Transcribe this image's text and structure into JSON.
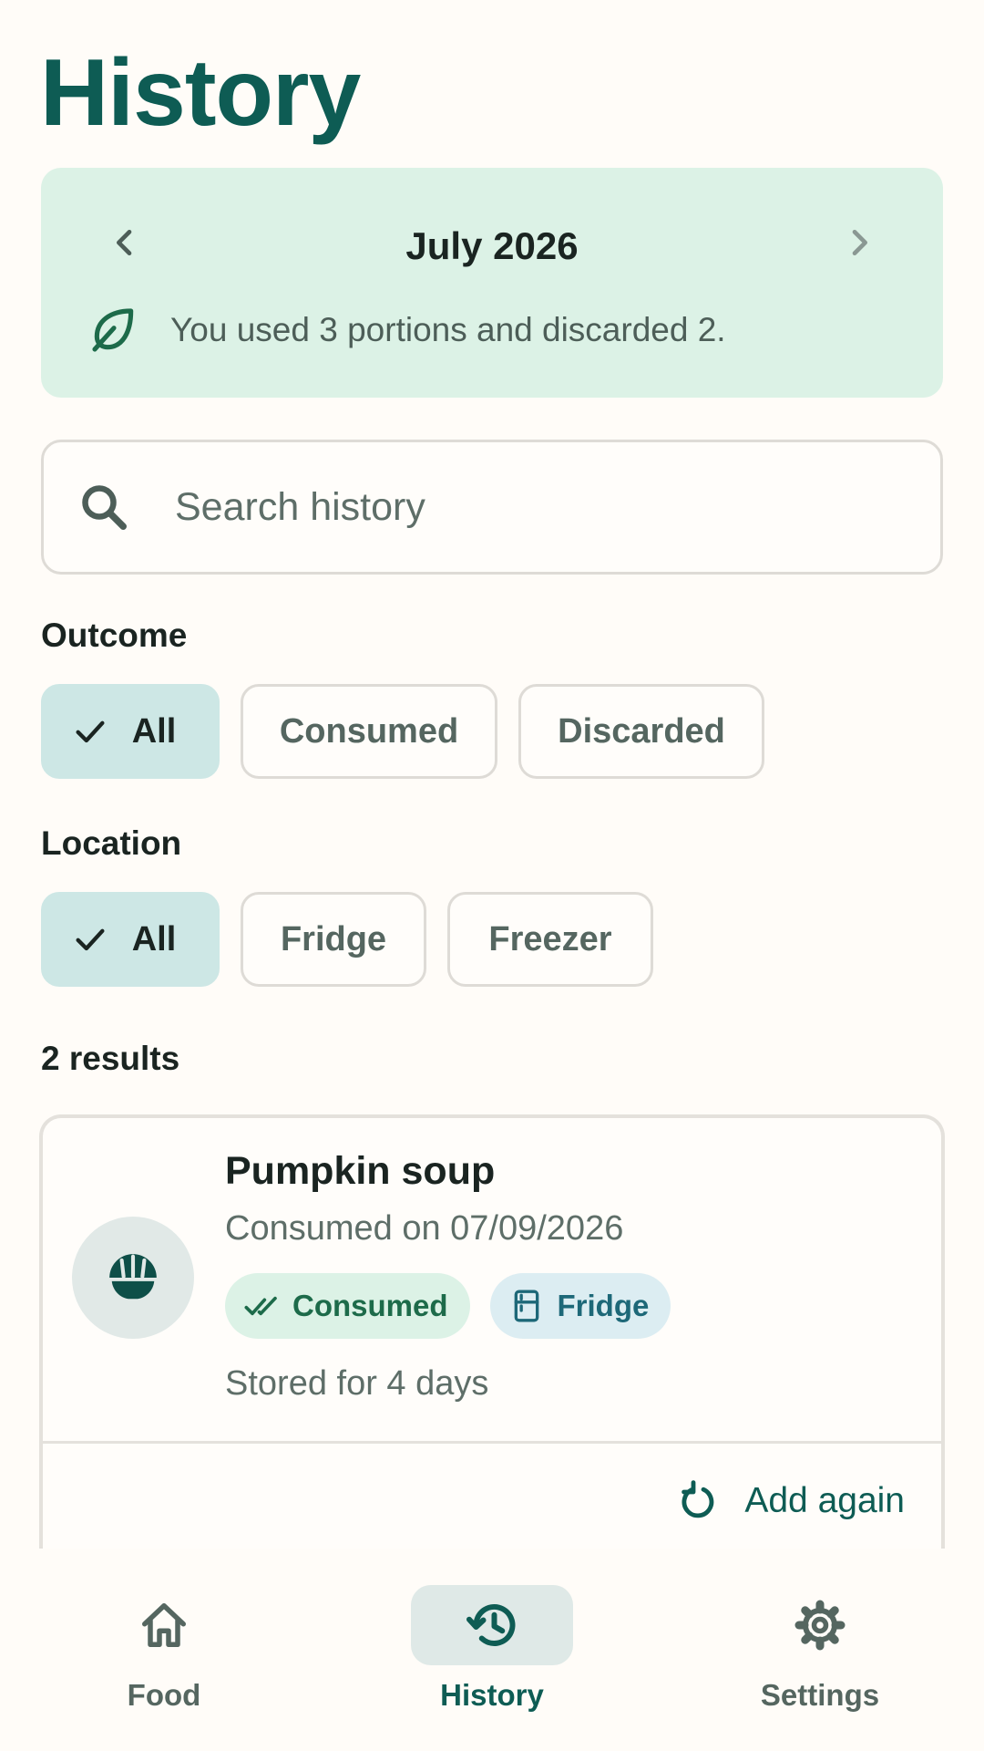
{
  "page": {
    "title": "History"
  },
  "month": {
    "label": "July 2026",
    "summary": "You used 3 portions and discarded 2."
  },
  "search": {
    "placeholder": "Search history",
    "value": ""
  },
  "filters": {
    "outcome": {
      "label": "Outcome",
      "options": [
        "All",
        "Consumed",
        "Discarded"
      ],
      "selected": "All"
    },
    "location": {
      "label": "Location",
      "options": [
        "All",
        "Fridge",
        "Freezer"
      ],
      "selected": "All"
    }
  },
  "results": {
    "count_label": "2 results",
    "items": [
      {
        "name": "Pumpkin soup",
        "date": "Consumed on 07/09/2026",
        "outcome_badge": "Consumed",
        "location_badge": "Fridge",
        "stored": "Stored for 4 days",
        "action": "Add again",
        "icon": "bowl-icon"
      }
    ]
  },
  "bottom_nav": {
    "items": [
      {
        "label": "Food",
        "icon": "home-icon"
      },
      {
        "label": "History",
        "icon": "history-icon",
        "active": true
      },
      {
        "label": "Settings",
        "icon": "gear-icon"
      }
    ]
  },
  "colors": {
    "primary": "#0e5c54",
    "month_card_bg": "#dcf2e6",
    "chip_selected_bg": "#cde7e5",
    "consumed_badge_bg": "#dcf2e6",
    "fridge_badge_bg": "#dcedf2"
  }
}
